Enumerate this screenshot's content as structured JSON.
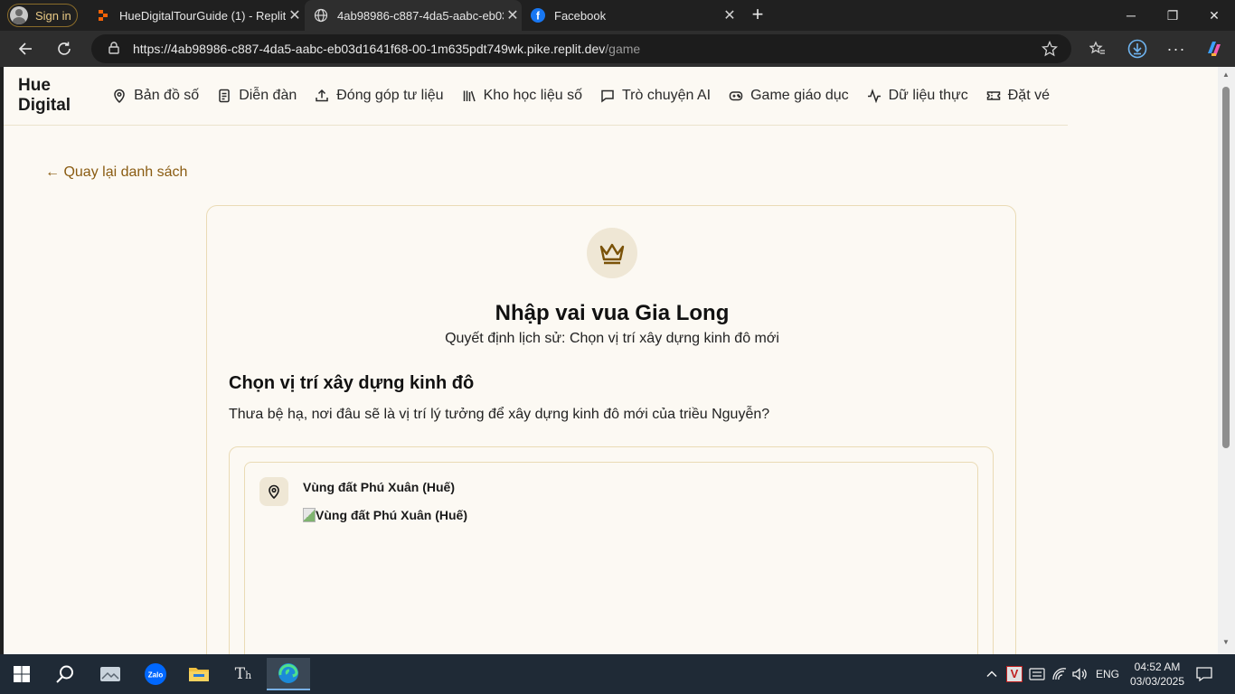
{
  "browser": {
    "signin_label": "Sign in",
    "tabs": [
      {
        "title": "HueDigitalTourGuide (1) - Replit"
      },
      {
        "title": "4ab98986-c887-4da5-aabc-eb03d"
      },
      {
        "title": "Facebook"
      }
    ],
    "url_host": "https://4ab98986-c887-4da5-aabc-eb03d1641f68-00-1m635pdt749wk.pike.replit.dev",
    "url_path": "/game"
  },
  "nav": {
    "brand": "Hue Digital",
    "items": [
      {
        "label": "Bản đồ số",
        "icon": "map-pin-icon"
      },
      {
        "label": "Diễn đàn",
        "icon": "document-icon"
      },
      {
        "label": "Đóng góp tư liệu",
        "icon": "upload-icon"
      },
      {
        "label": "Kho học liệu số",
        "icon": "library-icon"
      },
      {
        "label": "Trò chuyện AI",
        "icon": "chat-icon"
      },
      {
        "label": "Game giáo dục",
        "icon": "gamepad-icon"
      },
      {
        "label": "Dữ liệu thực",
        "icon": "activity-icon"
      },
      {
        "label": "Đặt vé",
        "icon": "ticket-icon"
      }
    ]
  },
  "game": {
    "back_link": "← Quay lại danh sách",
    "title": "Nhập vai vua Gia Long",
    "subtitle": "Quyết định lịch sử: Chọn vị trí xây dựng kinh đô mới",
    "question_title": "Chọn vị trí xây dựng kinh đô",
    "question_text": "Thưa bệ hạ, nơi đâu sẽ là vị trí lý tưởng để xây dựng kinh đô mới của triều Nguyễn?",
    "options": [
      {
        "name": "Vùng đất Phú Xuân (Huế)",
        "image_alt": "Vùng đất Phú Xuân (Huế)"
      }
    ]
  },
  "taskbar": {
    "language": "ENG",
    "time": "04:52 AM",
    "date": "03/03/2025"
  },
  "colors": {
    "page_bg": "#fcf9f3",
    "accent": "#8a5c12",
    "border": "#eadbb5"
  }
}
